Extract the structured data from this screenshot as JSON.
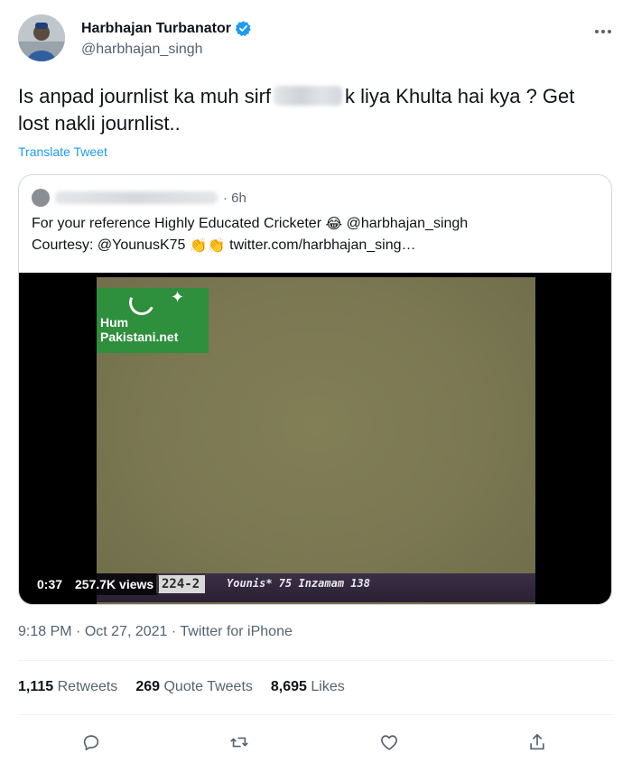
{
  "author": {
    "display_name": "Harbhajan Turbanator",
    "handle": "@harbhajan_singh"
  },
  "tweet": {
    "text_part1": "Is anpad journlist ka muh sirf",
    "text_part2": "k liya Khulta hai kya ? Get lost nakli journlist..",
    "translate_label": "Translate Tweet"
  },
  "quoted_tweet": {
    "time": "· 6h",
    "text_line1_a": "For your reference Highly Educated Cricketer",
    "text_line1_emoji": "😂",
    "text_line1_b": "@harbhajan_singh",
    "text_line2_a": "Courtesy: @YounusK75",
    "text_line2_emoji": "👏👏",
    "text_line2_b": "twitter.com/harbhajan_sing…"
  },
  "video": {
    "duration": "0:37",
    "views": "257.7K views",
    "logo_line1": "Hum",
    "logo_line2": "Pakistani.net",
    "score": "224-2",
    "players": "Younis* 75   Inzamam 138"
  },
  "meta": {
    "time": "9:18 PM",
    "date": "· Oct 27, 2021",
    "source": "· Twitter for iPhone"
  },
  "stats": {
    "retweets_count": "1,115",
    "retweets_label": "Retweets",
    "quotes_count": "269",
    "quotes_label": "Quote Tweets",
    "likes_count": "8,695",
    "likes_label": "Likes"
  },
  "colors": {
    "accent": "#1d9bf0",
    "secondary_text": "#536471",
    "border": "#cfd9de"
  },
  "icons": [
    "verified-badge-icon",
    "more-icon",
    "reply-icon",
    "retweet-icon",
    "like-icon",
    "share-icon"
  ]
}
